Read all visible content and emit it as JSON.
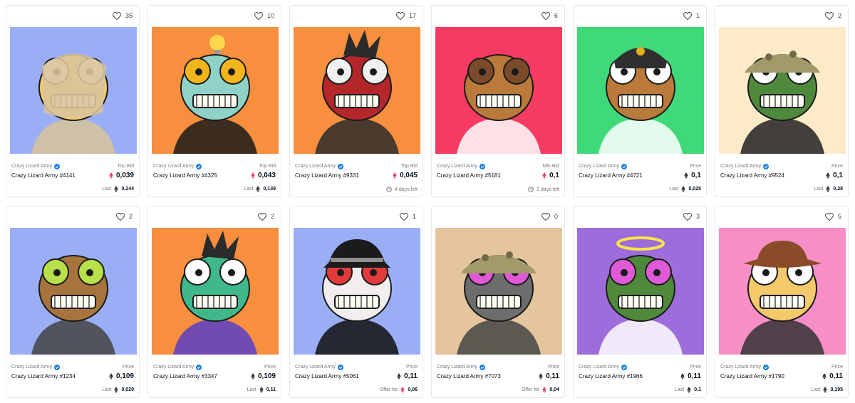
{
  "cards": [
    {
      "likes": "35",
      "collection": "Crazy Lizard Army",
      "name": "Crazy Lizard Army #4141",
      "price_label": "Top Bid",
      "price": "0,039",
      "eth_color": "pink",
      "footer_type": "last",
      "footer_label": "Last",
      "footer_value": "0,244",
      "bg": "#9aaef5",
      "skin": "#f3c96b",
      "eye": "#ffffff",
      "accent": "#d8c39a",
      "hat": "wrap"
    },
    {
      "likes": "10",
      "collection": "Crazy Lizard Army",
      "name": "Crazy Lizard Army #4325",
      "price_label": "Top Bid",
      "price": "0,043",
      "eth_color": "pink",
      "footer_type": "last",
      "footer_label": "Last",
      "footer_value": "0,139",
      "bg": "#f78f3e",
      "skin": "#8fd3c8",
      "eye": "#f2b51d",
      "accent": "#1b1b1b",
      "hat": "bulb"
    },
    {
      "likes": "17",
      "collection": "Crazy Lizard Army",
      "name": "Crazy Lizard Army #9331",
      "price_label": "Top Bid",
      "price": "0,045",
      "eth_color": "pink",
      "footer_type": "time",
      "footer_label": "4 days left",
      "footer_value": "",
      "bg": "#f78f3e",
      "skin": "#b3262a",
      "eye": "#f0f0f0",
      "accent": "#2b2b2b",
      "hat": "hair"
    },
    {
      "likes": "6",
      "collection": "Crazy Lizard Army",
      "name": "Crazy Lizard Army #5181",
      "price_label": "Min Bid",
      "price": "0,1",
      "eth_color": "pink",
      "footer_type": "time",
      "footer_label": "3 days left",
      "footer_value": "",
      "bg": "#f53b62",
      "skin": "#b97a3b",
      "eye": "#7a4a2a",
      "accent": "#ffffff",
      "hat": "none"
    },
    {
      "likes": "1",
      "collection": "Crazy Lizard Army",
      "name": "Crazy Lizard Army #4721",
      "price_label": "Price",
      "price": "0,1",
      "eth_color": "dark",
      "footer_type": "last",
      "footer_label": "Last",
      "footer_value": "0,025",
      "bg": "#3fd97a",
      "skin": "#b97a3b",
      "eye": "#ffffff",
      "accent": "#ffffff",
      "hat": "cap"
    },
    {
      "likes": "2",
      "collection": "Crazy Lizard Army",
      "name": "Crazy Lizard Army #9524",
      "price_label": "Price",
      "price": "0,1",
      "eth_color": "dark",
      "footer_type": "last",
      "footer_label": "Last",
      "footer_value": "0,28",
      "bg": "#fdebc8",
      "skin": "#4f8a3c",
      "eye": "#ffffff",
      "accent": "#222222",
      "hat": "bucket"
    },
    {
      "likes": "2",
      "collection": "Crazy Lizard Army",
      "name": "Crazy Lizard Army #1234",
      "price_label": "Price",
      "price": "0,109",
      "eth_color": "dark",
      "footer_type": "last",
      "footer_label": "Last",
      "footer_value": "0,029",
      "bg": "#9aaef5",
      "skin": "#a7743e",
      "eye": "#b7e04a",
      "accent": "#444444",
      "hat": "none"
    },
    {
      "likes": "2",
      "collection": "Crazy Lizard Army",
      "name": "Crazy Lizard Army #3347",
      "price_label": "Price",
      "price": "0,109",
      "eth_color": "dark",
      "footer_type": "last",
      "footer_label": "Last",
      "footer_value": "0,11",
      "bg": "#f78f3e",
      "skin": "#3fb88c",
      "eye": "#ffffff",
      "accent": "#5b3fc7",
      "hat": "hair"
    },
    {
      "likes": "1",
      "collection": "Crazy Lizard Army",
      "name": "Crazy Lizard Army #5061",
      "price_label": "Price",
      "price": "0,11",
      "eth_color": "dark",
      "footer_type": "offer",
      "footer_label": "Offer for",
      "footer_value": "0,06",
      "bg": "#9aaef5",
      "skin": "#f2eeee",
      "eye": "#e03a3a",
      "accent": "#111111",
      "hat": "fedora"
    },
    {
      "likes": "0",
      "collection": "Crazy Lizard Army",
      "name": "Crazy Lizard Army #7073",
      "price_label": "Price",
      "price": "0,11",
      "eth_color": "dark",
      "footer_type": "offer",
      "footer_label": "Offer for",
      "footer_value": "0,04",
      "bg": "#e5c59e",
      "skin": "#6d6d6d",
      "eye": "#e05ad8",
      "accent": "#444444",
      "hat": "bucket"
    },
    {
      "likes": "3",
      "collection": "Crazy Lizard Army",
      "name": "Crazy Lizard Army #1966",
      "price_label": "Price",
      "price": "0,11",
      "eth_color": "dark",
      "footer_type": "last",
      "footer_label": "Last",
      "footer_value": "0,1",
      "bg": "#9d6ddc",
      "skin": "#4f8a3c",
      "eye": "#e05ad8",
      "accent": "#ffffff",
      "hat": "halo"
    },
    {
      "likes": "5",
      "collection": "Crazy Lizard Army",
      "name": "Crazy Lizard Army #1790",
      "price_label": "Price",
      "price": "0,11",
      "eth_color": "dark",
      "footer_type": "last",
      "footer_label": "Last",
      "footer_value": "0,195",
      "bg": "#f78fc6",
      "skin": "#f3c96b",
      "eye": "#ffffff",
      "accent": "#333333",
      "hat": "cowboy"
    }
  ],
  "colors": {
    "eth_pink": "#e84170",
    "eth_dark": "#353840",
    "verified": "#2081e2",
    "text_muted": "#707a83",
    "border": "#e5e8eb"
  }
}
